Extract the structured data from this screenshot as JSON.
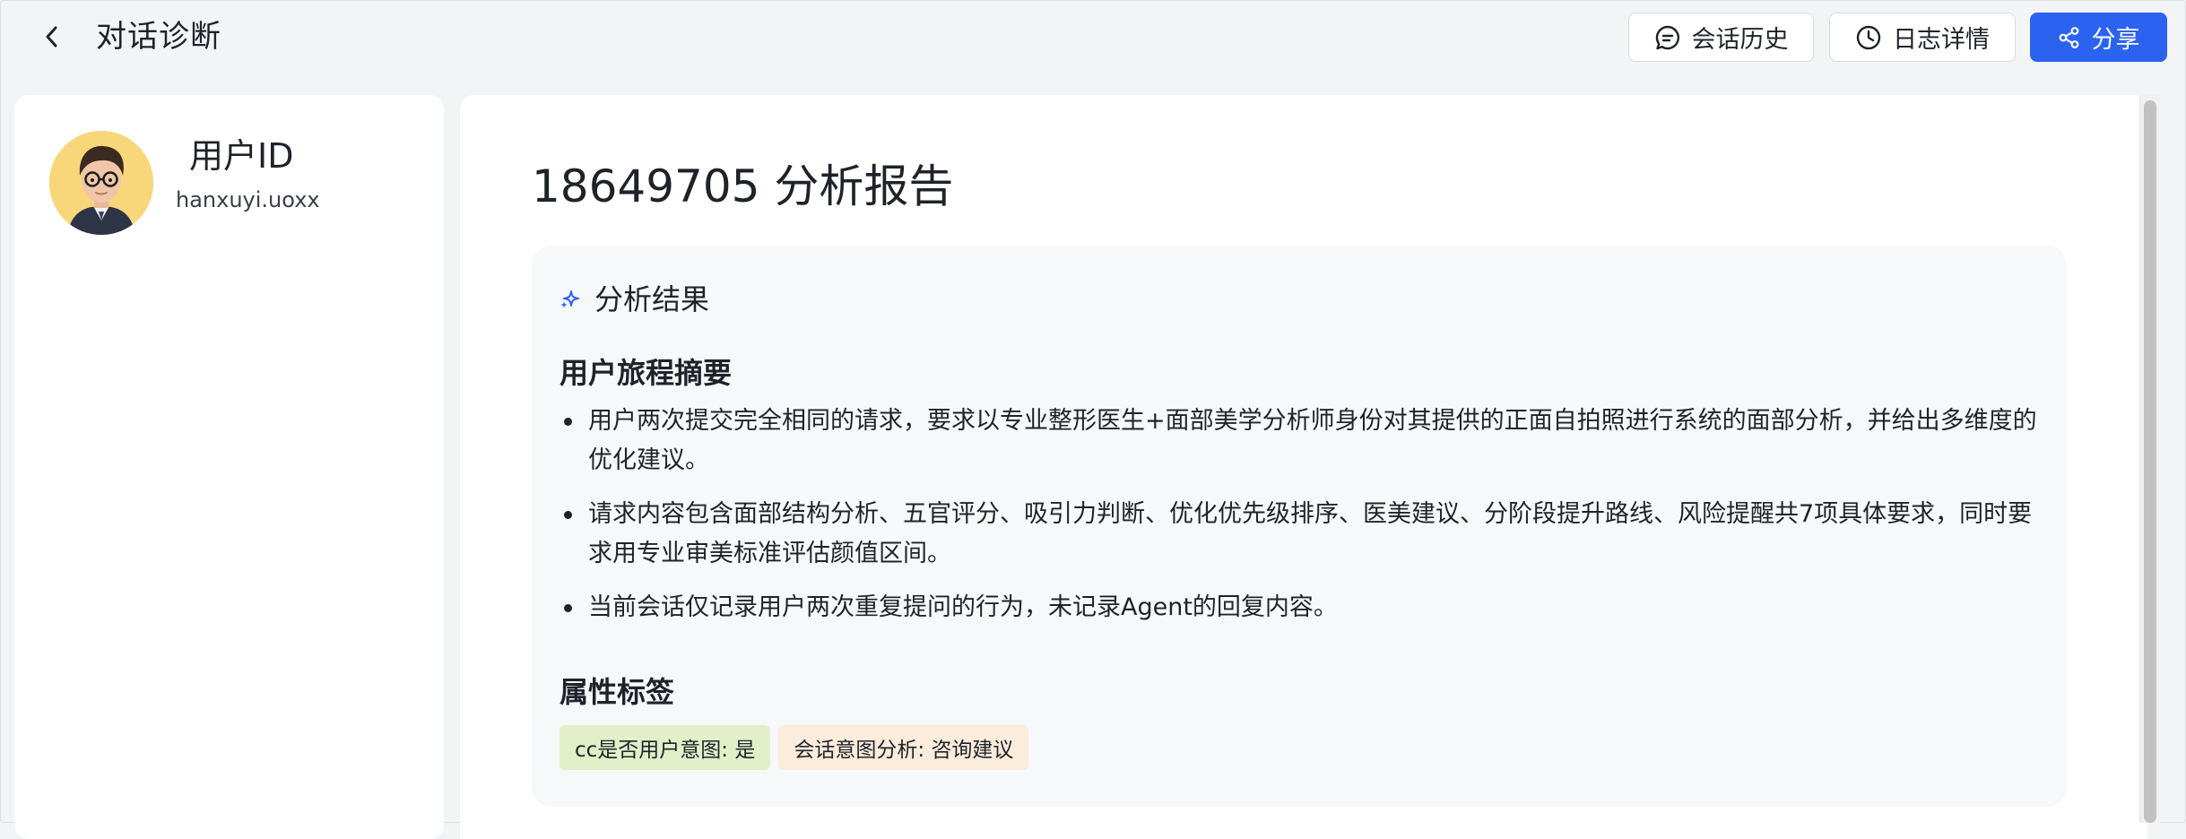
{
  "header": {
    "title": "对话诊断",
    "buttons": {
      "history": "会话历史",
      "log": "日志详情",
      "share": "分享"
    }
  },
  "user": {
    "id_label": "用户ID",
    "name": "hanxuyi.uoxx"
  },
  "report": {
    "title": "18649705 分析报告",
    "analysis_title": "分析结果",
    "summary_title": "用户旅程摘要",
    "summary_items": [
      "用户两次提交完全相同的请求，要求以专业整形医生+面部美学分析师身份对其提供的正面自拍照进行系统的面部分析，并给出多维度的优化建议。",
      "请求内容包含面部结构分析、五官评分、吸引力判断、优化优先级排序、医美建议、分阶段提升路线、风险提醒共7项具体要求，同时要求用专业审美标准评估颜值区间。",
      "当前会话仅记录用户两次重复提问的行为，未记录Agent的回复内容。"
    ],
    "tags_title": "属性标签",
    "tags": [
      "cc是否用户意图: 是",
      "会话意图分析: 咨询建议"
    ]
  },
  "colors": {
    "accent": "#2b63f0",
    "tag_green": "#e3efc9",
    "tag_orange": "#fbecdc"
  },
  "icons": [
    "back-arrow-icon",
    "chat-bubble-icon",
    "clock-icon",
    "share-icon",
    "sparkle-icon"
  ]
}
